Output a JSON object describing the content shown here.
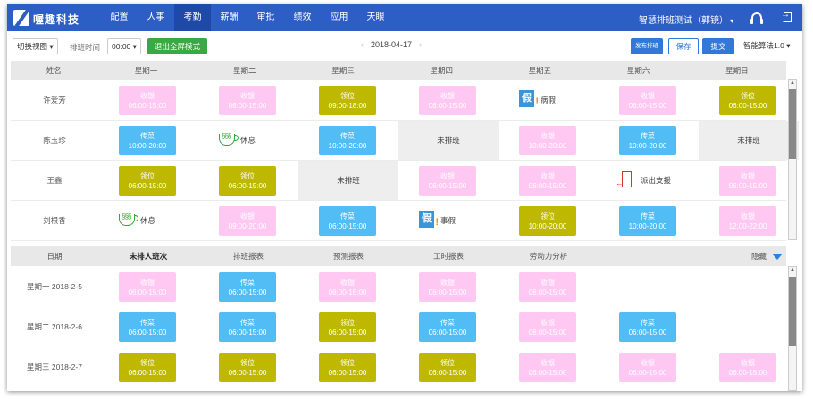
{
  "app": {
    "brand": "喔趣科技",
    "nav": [
      "配置",
      "人事",
      "考勤",
      "薪酬",
      "审批",
      "绩效",
      "应用",
      "天眼"
    ],
    "active_nav": "考勤",
    "user": "智慧排班测试（郭镜）"
  },
  "toolbar": {
    "switch_view": "切换视图",
    "shift_time_label": "排班时间",
    "shift_time_value": "00:00",
    "exit_fullscreen": "退出全屏模式",
    "date": "2018-04-17",
    "publish": "发布排班",
    "save": "保存",
    "submit": "提交",
    "algorithm": "智能算法1.0"
  },
  "top_header": [
    "姓名",
    "星期一",
    "星期二",
    "星期三",
    "星期四",
    "星期五",
    "星期六",
    "星期日"
  ],
  "employees": [
    {
      "name": "许爱芳",
      "cells": [
        {
          "kind": "card",
          "color": "pink",
          "title": "收银",
          "time": "06:00-15:00"
        },
        {
          "kind": "card",
          "color": "pink",
          "title": "收银",
          "time": "06:00-15:00"
        },
        {
          "kind": "card",
          "color": "olive",
          "title": "领位",
          "time": "09:00-18:00"
        },
        {
          "kind": "card",
          "color": "pink",
          "title": "收银",
          "time": "06:00-15:00"
        },
        {
          "kind": "leave",
          "icon": "sick-leave-icon",
          "label": "病假"
        },
        {
          "kind": "card",
          "color": "pink",
          "title": "收银",
          "time": "06:00-15:00"
        },
        {
          "kind": "card",
          "color": "olive",
          "title": "领位",
          "time": "06:00-15:00"
        }
      ]
    },
    {
      "name": "陈玉珍",
      "cells": [
        {
          "kind": "card",
          "color": "blue",
          "title": "传菜",
          "time": "10:00-20:00"
        },
        {
          "kind": "leave",
          "icon": "rest-cup-icon",
          "label": "休息"
        },
        {
          "kind": "card",
          "color": "blue",
          "title": "传菜",
          "time": "10:00-20:00"
        },
        {
          "kind": "unsched",
          "label": "未排班"
        },
        {
          "kind": "card",
          "color": "pink",
          "title": "收银",
          "time": "10:00-20:00"
        },
        {
          "kind": "card",
          "color": "blue",
          "title": "传菜",
          "time": "10:00-20:00"
        },
        {
          "kind": "unsched",
          "label": "未排班"
        }
      ]
    },
    {
      "name": "王鑫",
      "cells": [
        {
          "kind": "card",
          "color": "olive",
          "title": "领位",
          "time": "06:00-15:00"
        },
        {
          "kind": "card",
          "color": "olive",
          "title": "领位",
          "time": "06:00-15:00"
        },
        {
          "kind": "unsched",
          "label": "未排班"
        },
        {
          "kind": "card",
          "color": "pink",
          "title": "收银",
          "time": "06:00-15:00"
        },
        {
          "kind": "card",
          "color": "pink",
          "title": "收银",
          "time": "06:00-15:00"
        },
        {
          "kind": "leave",
          "icon": "dispatch-door-icon",
          "label": "派出支援"
        },
        {
          "kind": "card",
          "color": "pink",
          "title": "收银",
          "time": "06:00-15:00"
        }
      ]
    },
    {
      "name": "刘根香",
      "cells": [
        {
          "kind": "leave",
          "icon": "rest-cup-icon",
          "label": "休息"
        },
        {
          "kind": "card",
          "color": "pink",
          "title": "收银",
          "time": "09:00-20:00"
        },
        {
          "kind": "card",
          "color": "blue",
          "title": "传菜",
          "time": "06:00-15:00"
        },
        {
          "kind": "leave",
          "icon": "personal-leave-icon",
          "label": "事假"
        },
        {
          "kind": "card",
          "color": "olive",
          "title": "领位",
          "time": "10:00-20:00"
        },
        {
          "kind": "card",
          "color": "blue",
          "title": "传菜",
          "time": "10:00-20:00"
        },
        {
          "kind": "card",
          "color": "pink",
          "title": "收银",
          "time": "12:00-22:00"
        }
      ]
    }
  ],
  "bottom_header": {
    "date": "日期",
    "tabs": [
      "未排人班次",
      "排班报表",
      "预测报表",
      "工时报表",
      "劳动力分析"
    ],
    "hide": "隐藏"
  },
  "unassigned": [
    {
      "date": "星期一  2018-2-5",
      "cells": [
        {
          "kind": "card",
          "color": "pink",
          "title": "收银",
          "time": "06:00-15:00"
        },
        {
          "kind": "card",
          "color": "blue",
          "title": "传菜",
          "time": "06:00-15:00"
        },
        {
          "kind": "card",
          "color": "pink",
          "title": "收银",
          "time": "06:00-15:00"
        },
        {
          "kind": "card",
          "color": "pink",
          "title": "收银",
          "time": "06:00-15:00"
        },
        {
          "kind": "card",
          "color": "pink",
          "title": "收银",
          "time": "06:00-15:00"
        }
      ]
    },
    {
      "date": "星期二  2018-2-6",
      "cells": [
        {
          "kind": "card",
          "color": "blue",
          "title": "传菜",
          "time": "06:00-15:00"
        },
        {
          "kind": "card",
          "color": "blue",
          "title": "传菜",
          "time": "06:00-15:00"
        },
        {
          "kind": "card",
          "color": "olive",
          "title": "领位",
          "time": "06:00-15:00"
        },
        {
          "kind": "card",
          "color": "blue",
          "title": "传菜",
          "time": "06:00-15:00"
        },
        {
          "kind": "card",
          "color": "pink",
          "title": "收银",
          "time": "06:00-15:00"
        },
        {
          "kind": "card",
          "color": "blue",
          "title": "传菜",
          "time": "06:00-15:00"
        }
      ]
    },
    {
      "date": "星期三  2018-2-7",
      "cells": [
        {
          "kind": "card",
          "color": "olive",
          "title": "领位",
          "time": "06:00-15:00"
        },
        {
          "kind": "card",
          "color": "olive",
          "title": "领位",
          "time": "06:00-15:00"
        },
        {
          "kind": "card",
          "color": "olive",
          "title": "领位",
          "time": "06:00-15:00"
        },
        {
          "kind": "card",
          "color": "olive",
          "title": "领位",
          "time": "06:00-15:00"
        },
        {
          "kind": "card",
          "color": "pink",
          "title": "收银",
          "time": "06:00-15:00"
        },
        {
          "kind": "card",
          "color": "pink",
          "title": "收银",
          "time": "06:00-15:00"
        },
        {
          "kind": "card",
          "color": "pink",
          "title": "收银",
          "time": "06:00-15:00"
        }
      ]
    }
  ]
}
